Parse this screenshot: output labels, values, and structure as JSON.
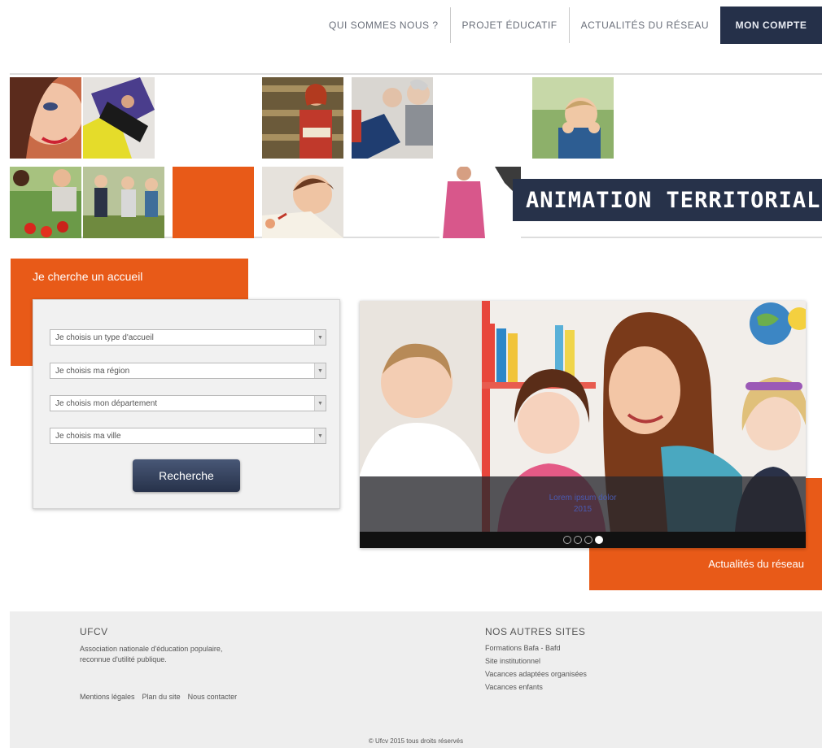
{
  "nav": {
    "items": [
      "QUI SOMMES NOUS ?",
      "PROJET ÉDUCATIF",
      "ACTUALITÉS DU RÉSEAU"
    ],
    "account": "MON COMPTE",
    "account_color": "#253049"
  },
  "banner": {
    "title": "ANIMATION TERRITORIALE",
    "accent": "#e85a18"
  },
  "search": {
    "tab_label": "Je cherche un accueil",
    "selects": [
      "Je choisis un type d'accueil",
      "Je choisis ma région",
      "Je choisis mon département",
      "Je choisis ma ville"
    ],
    "button": "Recherche"
  },
  "news": {
    "caption_line1": "Lorem ipsum dolor",
    "caption_line2": "2015",
    "label": "Actualités du réseau",
    "slides": 4,
    "active_slide": 4
  },
  "footer": {
    "org_title": "UFCV",
    "org_desc_line1": "Association nationale d'éducation populaire,",
    "org_desc_line2": "reconnue d'utilité publique.",
    "legal_links": [
      "Mentions légales",
      "Plan du site",
      "Nous contacter"
    ],
    "sites_title": "NOS AUTRES SITES",
    "sites": [
      "Formations Bafa - Bafd",
      "Site institutionnel",
      "Vacances adaptées organisées",
      "Vacances enfants"
    ],
    "copyright": "© Ufcv 2015 tous droits réservés"
  }
}
